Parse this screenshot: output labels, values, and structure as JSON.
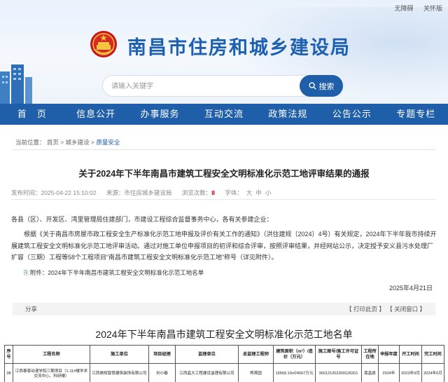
{
  "header": {
    "top_links": [
      "无障碍",
      "关怀版"
    ],
    "site_title": "南昌市住房和城乡建设局",
    "search_placeholder": "请输入关键字",
    "search_button": "搜索"
  },
  "nav": [
    "首　页",
    "信息公开",
    "办事服务",
    "互动交流",
    "政策法规",
    "公告公示",
    "专题专栏"
  ],
  "breadcrumb": {
    "prefix": "当前位置：",
    "items": [
      "首页",
      "城乡建设",
      "质量安全"
    ],
    "separator": ">"
  },
  "article": {
    "title": "关于2024年下半年南昌市建筑工程安全文明标准化示范工地评审结果的通报",
    "meta": {
      "publish_label": "发布时间：",
      "publish_time": "2025-04-22 15:10:02",
      "source_label": "来源：",
      "source": "市住房城乡建设局",
      "views_label": "浏览次数：",
      "views": "8",
      "fontsize_label": "字体：",
      "fontsize_options": [
        "大",
        "中",
        "小"
      ]
    },
    "salutation": "各县（区）、开发区、湾里管理局住建部门，市建设工程综合监督事务中心，各有关参建企业：",
    "body": "根据《关于南昌市房屋市政工程安全生产标准化示范工地申报及评价有关工作的通知》（洪住建规〔2024〕4号）有关规定，2024年下半年我市持续开展建筑工程安全文明标准化示范工地评审活动。通过对施工单位申报项目的初评和综合评审，按照评审结果，并经网站公示，决定授予安义县污水处理厂扩容（三期）工程等58个工程项目“南昌市建筑工程安全文明标准化示范工地”称号（详见附件）。",
    "attachment": "附件：2024年下半年南昌市建筑工程安全文明标准化示范工地名单",
    "date": "2025年4月21日"
  },
  "share": {
    "label": "分享",
    "print_label": "【 打印此页 】",
    "close_label": "【 关闭窗口 】"
  },
  "attachment_table": {
    "title": "2024年下半年南昌市建筑工程安全文明标准化示范工地名单",
    "headers": [
      "序号",
      "工程名称",
      "施工单位",
      "项目经理",
      "监理单位",
      "总监理工程师",
      "建筑面积（m²）/造价（万元）",
      "施工图号/施工许可证号",
      "工程所在地",
      "申报年度",
      "开工时间",
      "完工时间"
    ],
    "rows": [
      [
        "38",
        "江西泰豪动漫学院三期项目（1-11#楼学术交流中心、科研楼）",
        "江西晟辉智慧建筑装饰有限公司",
        "刘小春",
        "江西昌大工程建设监理有限公司",
        "熊燕国",
        "19569.19㎡/4007万元",
        "360121202309120201",
        "南昌县",
        "2024年",
        "2023年9月",
        "2024年6月"
      ]
    ]
  }
}
